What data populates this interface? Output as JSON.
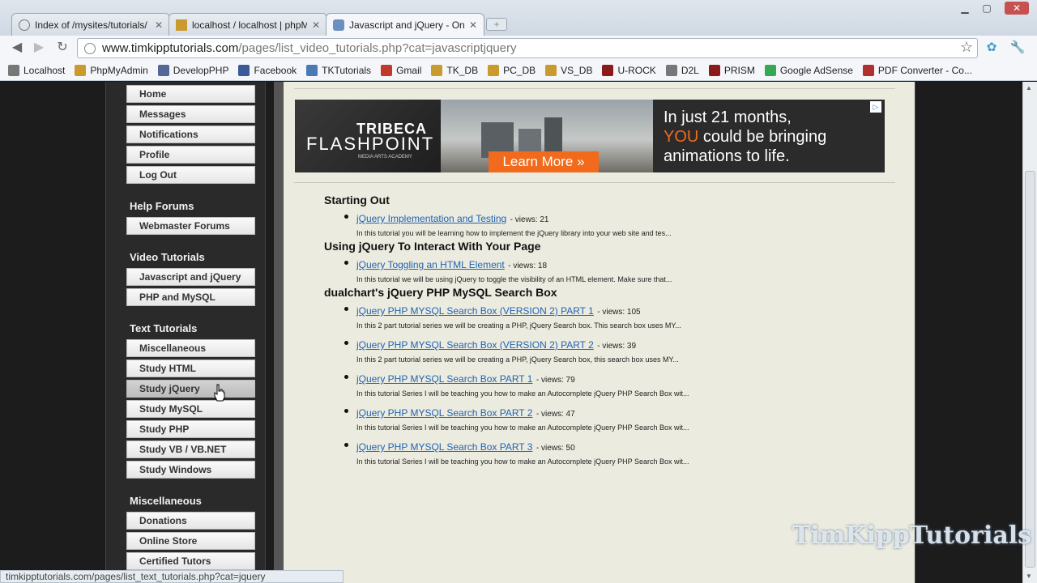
{
  "tabs": [
    {
      "title": "Index of /mysites/tutorials/",
      "icon": "folder-icon"
    },
    {
      "title": "localhost / localhost | phpM",
      "icon": "pma-icon"
    },
    {
      "title": "Javascript and jQuery - Onl",
      "icon": "page-icon"
    }
  ],
  "address": {
    "domain": "www.timkipptutorials.com",
    "path": "/pages/list_video_tutorials.php?cat=javascriptjquery"
  },
  "bookmarks": [
    {
      "label": "Localhost",
      "icon": "globe-icon",
      "color": "#777777"
    },
    {
      "label": "PhpMyAdmin",
      "icon": "pma-icon",
      "color": "#c99a2e"
    },
    {
      "label": "DevelopPHP",
      "icon": "php-icon",
      "color": "#556699"
    },
    {
      "label": "Facebook",
      "icon": "facebook-icon",
      "color": "#3b5998"
    },
    {
      "label": "TKTutorials",
      "icon": "tk-icon",
      "color": "#4a7ab5"
    },
    {
      "label": "Gmail",
      "icon": "gmail-icon",
      "color": "#c0392b"
    },
    {
      "label": "TK_DB",
      "icon": "pma-icon",
      "color": "#c99a2e"
    },
    {
      "label": "PC_DB",
      "icon": "pma-icon",
      "color": "#c99a2e"
    },
    {
      "label": "VS_DB",
      "icon": "pma-icon",
      "color": "#c99a2e"
    },
    {
      "label": "U-ROCK",
      "icon": "urock-icon",
      "color": "#8b1a1a"
    },
    {
      "label": "D2L",
      "icon": "globe-icon",
      "color": "#777777"
    },
    {
      "label": "PRISM",
      "icon": "prism-icon",
      "color": "#8b1a1a"
    },
    {
      "label": "Google AdSense",
      "icon": "google-icon",
      "color": "#34a853"
    },
    {
      "label": "PDF Converter - Co...",
      "icon": "pdf-icon",
      "color": "#b03030"
    }
  ],
  "sidebar": {
    "account": [
      "Home",
      "Messages",
      "Notifications",
      "Profile",
      "Log Out"
    ],
    "help_heading": "Help Forums",
    "help": [
      "Webmaster Forums"
    ],
    "video_heading": "Video Tutorials",
    "video": [
      "Javascript and jQuery",
      "PHP and MySQL"
    ],
    "text_heading": "Text Tutorials",
    "text": [
      "Miscellaneous",
      "Study HTML",
      "Study jQuery",
      "Study MySQL",
      "Study PHP",
      "Study VB / VB.NET",
      "Study Windows"
    ],
    "misc_heading": "Miscellaneous",
    "misc": [
      "Donations",
      "Online Store",
      "Certified Tutors"
    ]
  },
  "ad": {
    "brand_line1": "TRIBECA",
    "brand_line2": "FLASHPOINT",
    "brand_line3": "MEDIA ARTS ACADEMY",
    "button": "Learn More »",
    "text_pre": "In just 21 months,",
    "text_highlight": "YOU",
    "text_post": "could be bringing animations to life."
  },
  "sections": [
    {
      "title": "Starting Out",
      "items": [
        {
          "link": "jQuery Implementation and Testing",
          "views": "- views: 21",
          "desc": "In this tutorial you will be learning how to implement the jQuery library into your web site and tes..."
        }
      ]
    },
    {
      "title": "Using jQuery To Interact With Your Page",
      "items": [
        {
          "link": "jQuery Toggling an HTML Element",
          "views": "- views: 18",
          "desc": "In this tutorial we will be using jQuery to toggle the visibility of an HTML element. Make sure that..."
        }
      ]
    },
    {
      "title": "dualchart's jQuery PHP MySQL Search Box",
      "items": [
        {
          "link": "jQuery PHP MYSQL Search Box (VERSION 2) PART 1",
          "views": "- views: 105",
          "desc": "In this 2 part tutorial series we will be creating a PHP, jQuery Search box. This search box uses MY..."
        },
        {
          "link": "jQuery PHP MYSQL Search Box (VERSION 2) PART 2",
          "views": "- views: 39",
          "desc": "In this 2 part tutorial series we will be creating a PHP, jQuery Search box, this search box uses MY..."
        },
        {
          "link": "jQuery PHP MYSQL Search Box PART 1",
          "views": "- views: 79",
          "desc": "In this tutorial Series I will be teaching you how to make an Autocomplete jQuery PHP Search Box wit..."
        },
        {
          "link": "jQuery PHP MYSQL Search Box PART 2",
          "views": "- views: 47",
          "desc": "In this tutorial Series I will be teaching you how to make an Autocomplete jQuery PHP Search Box wit..."
        },
        {
          "link": "jQuery PHP MYSQL Search Box PART 3",
          "views": "- views: 50",
          "desc": "In this tutorial Series I will be teaching you how to make an Autocomplete jQuery PHP Search Box wit..."
        }
      ]
    }
  ],
  "watermark": "TimKippTutorials",
  "status_url": "timkipptutorials.com/pages/list_text_tutorials.php?cat=jquery",
  "colors": {
    "link": "#1f63b5",
    "page_bg": "#ecebdf",
    "ad_accent": "#f26a1b",
    "sidebar_bg": "#2a2a2a"
  }
}
